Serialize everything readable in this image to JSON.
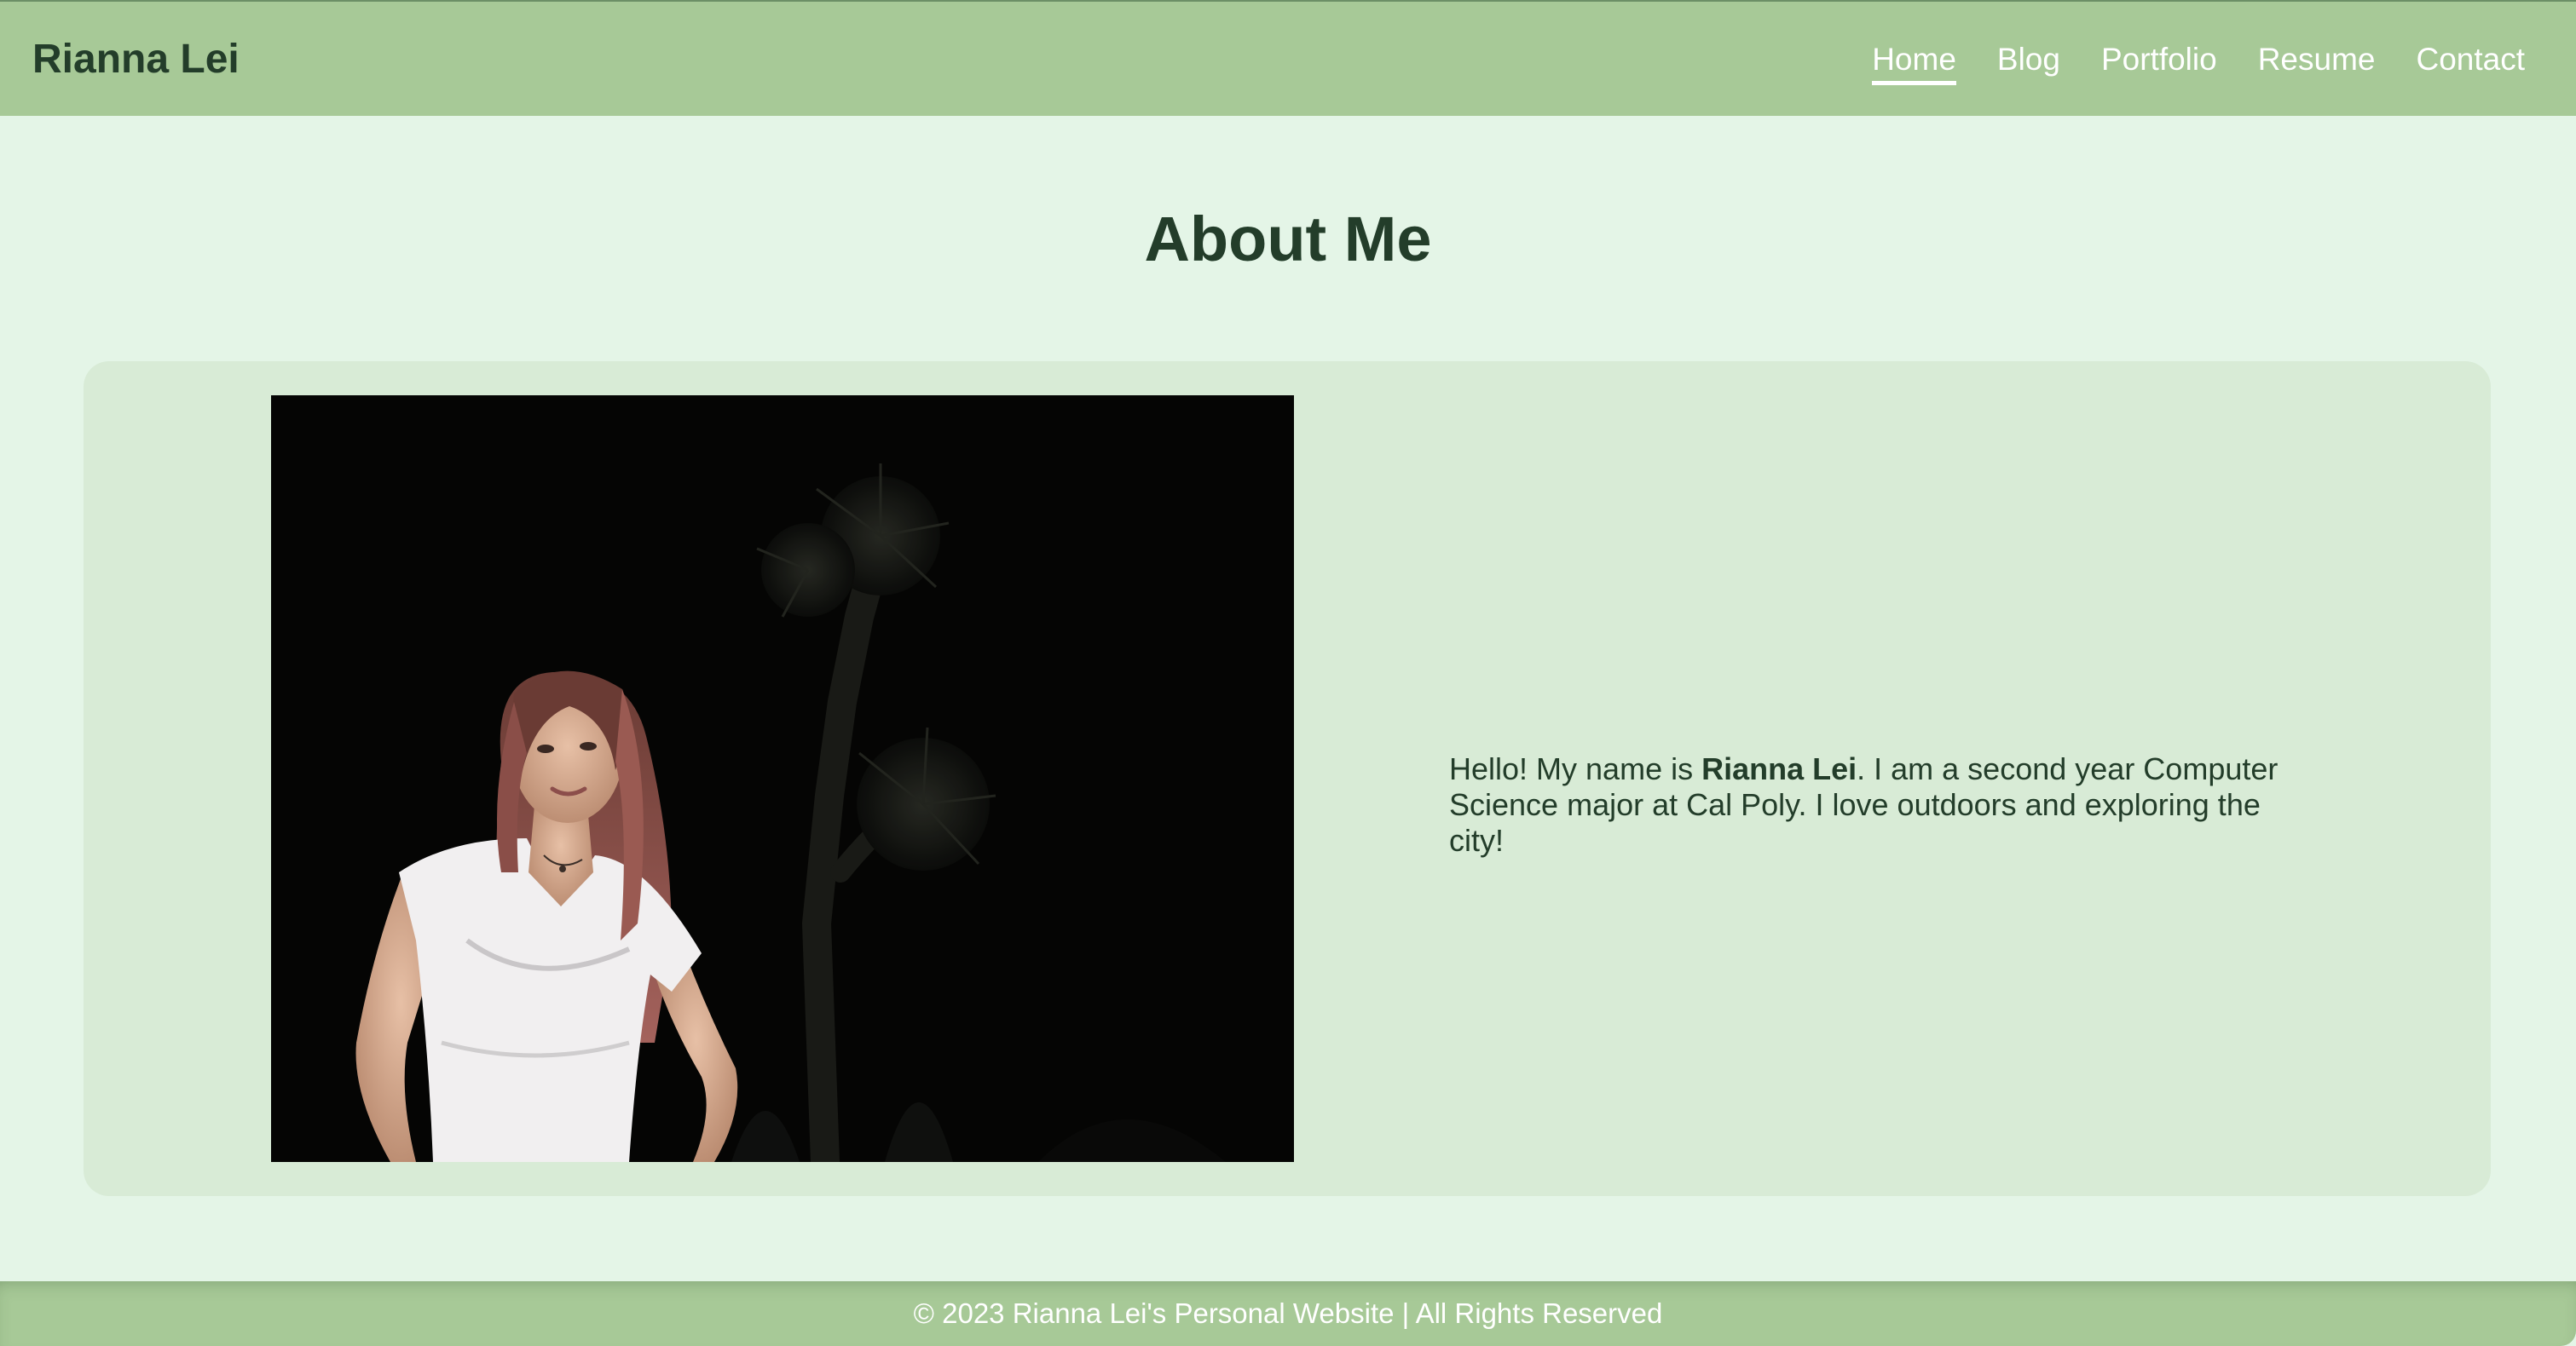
{
  "header": {
    "brand": "Rianna Lei",
    "nav": [
      {
        "label": "Home",
        "active": true
      },
      {
        "label": "Blog",
        "active": false
      },
      {
        "label": "Portfolio",
        "active": false
      },
      {
        "label": "Resume",
        "active": false
      },
      {
        "label": "Contact",
        "active": false
      }
    ]
  },
  "main": {
    "title": "About Me",
    "bio": {
      "before": "Hello! My name is ",
      "name": "Rianna Lei",
      "after": ". I am a second year Computer Science major at Cal Poly. I love outdoors and exploring the city!"
    }
  },
  "footer": {
    "text": "© 2023 Rianna Lei's Personal Website | All Rights Reserved"
  },
  "colors": {
    "header_bg": "#a7c997",
    "page_bg": "#e4f5e7",
    "card_bg": "#d8ebd6",
    "text_dark": "#233d2a",
    "nav_text": "#ffffff"
  },
  "icons": {
    "profile_photo": "portrait-photo-night-joshua-tree"
  }
}
